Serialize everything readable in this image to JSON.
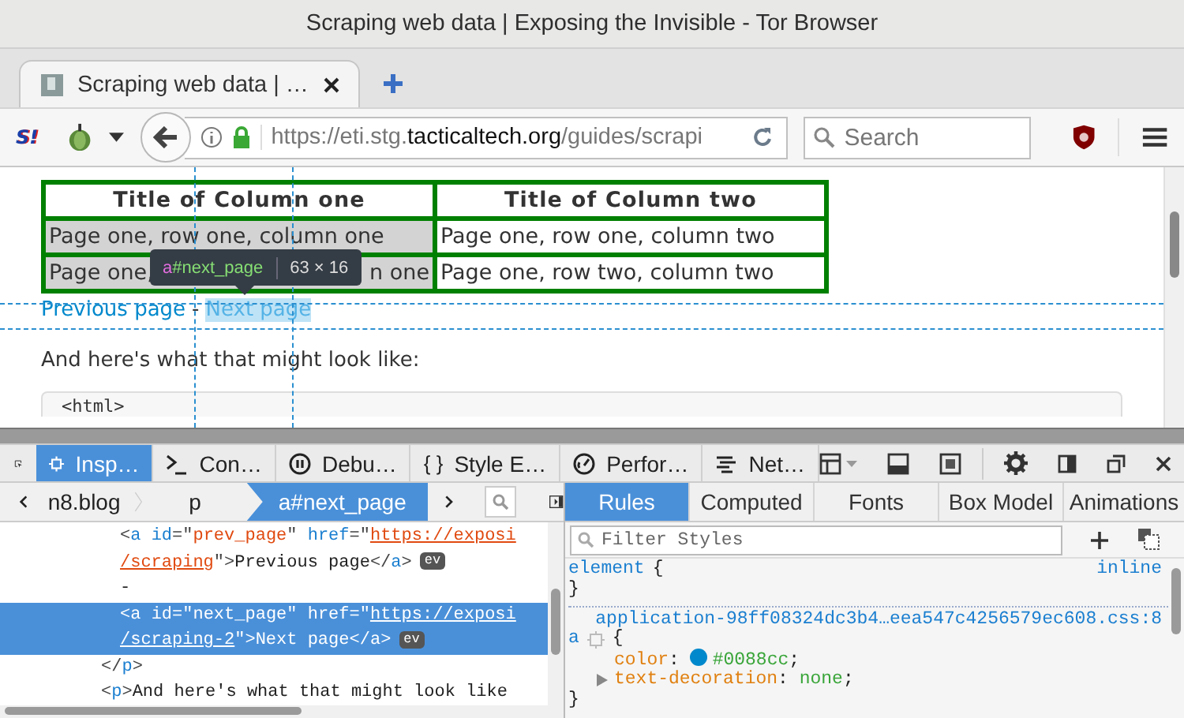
{
  "window": {
    "title": "Scraping web data | Exposing the Invisible - Tor Browser"
  },
  "tabs": [
    {
      "label": "Scraping web data | …",
      "selected": true
    }
  ],
  "toolbar": {
    "script_badge": "S!"
  },
  "address_bar": {
    "url_prefix": "https://eti.stg.",
    "url_domain": "tacticaltech.org",
    "url_path": "/guides/scrapi",
    "secure": true
  },
  "search": {
    "placeholder": "Search"
  },
  "page": {
    "table": {
      "columns": [
        "Title of Column one",
        "Title of Column two"
      ],
      "rows": [
        {
          "cells": [
            {
              "text": "Page one, row one, column one",
              "shaded": true
            },
            {
              "text": "Page one, row one, column two",
              "shaded": false
            }
          ]
        },
        {
          "cells": [
            {
              "segments": [
                "Page one,",
                "n one"
              ],
              "shaded": true
            },
            {
              "text": "Page one, row two, column two",
              "shaded": false
            }
          ]
        }
      ]
    },
    "links": [
      {
        "label": "Previous page",
        "highlighted": false
      },
      {
        "label": "Next page",
        "highlighted": true
      }
    ],
    "link_separator": "-",
    "paragraph": "And here's what that might look like:",
    "code": "<html>",
    "highlighter": {
      "tag": "a",
      "selector": "#next_page",
      "size": "63 × 16"
    }
  },
  "devtools": {
    "tools": [
      {
        "label": "Insp…",
        "kind": "inspector",
        "selected": true
      },
      {
        "label": "Con…",
        "kind": "console",
        "selected": false
      },
      {
        "label": "Debu…",
        "kind": "debugger",
        "selected": false
      },
      {
        "label": "Style E…",
        "kind": "style-editor",
        "glyph": "{ }",
        "selected": false
      },
      {
        "label": "Perfor…",
        "kind": "performance",
        "selected": false
      },
      {
        "label": "Net…",
        "kind": "network",
        "selected": false
      }
    ],
    "breadcrumbs": [
      {
        "label": "n8.blog",
        "selected": false
      },
      {
        "label": "p",
        "selected": false
      },
      {
        "label": "a#next_page",
        "selected": true
      }
    ],
    "side_tabs": [
      {
        "label": "Rules",
        "selected": true
      },
      {
        "label": "Computed",
        "selected": false
      },
      {
        "label": "Fonts",
        "selected": false
      },
      {
        "label": "Box Model",
        "selected": false
      },
      {
        "label": "Animations",
        "selected": false
      }
    ],
    "markup": [
      {
        "closing": [
          {
            "t": "</",
            "kind": "punct"
          },
          {
            "t": "p",
            "kind": "tag"
          },
          {
            "t": ">",
            "kind": "punct"
          }
        ],
        "children": [
          {
            "selected": false,
            "badge": "ev",
            "lines": [
              [
                {
                  "t": "<",
                  "kind": "punct"
                },
                {
                  "t": "a",
                  "kind": "tag"
                },
                {
                  "t": " id",
                  "kind": "attr"
                },
                {
                  "t": "=\"",
                  "kind": "punct"
                },
                {
                  "t": "prev_page",
                  "kind": "value"
                },
                {
                  "t": "\" ",
                  "kind": "punct"
                },
                {
                  "t": "href",
                  "kind": "attr"
                },
                {
                  "t": "=\"",
                  "kind": "punct"
                },
                {
                  "t": "https://exposi",
                  "kind": "link"
                }
              ],
              [
                {
                  "t": "/scraping",
                  "kind": "link"
                },
                {
                  "t": "\">",
                  "kind": "punct"
                },
                {
                  "t": "Previous page",
                  "kind": "text"
                },
                {
                  "t": "</",
                  "kind": "punct"
                },
                {
                  "t": "a",
                  "kind": "tag"
                },
                {
                  "t": ">",
                  "kind": "punct"
                }
              ]
            ]
          },
          {
            "selected": false,
            "lines": [
              [
                {
                  "t": "-",
                  "kind": "text"
                }
              ]
            ]
          },
          {
            "selected": true,
            "badge": "ev",
            "lines": [
              [
                {
                  "t": "<",
                  "kind": "punct"
                },
                {
                  "t": "a",
                  "kind": "tag"
                },
                {
                  "t": " id",
                  "kind": "attr"
                },
                {
                  "t": "=\"",
                  "kind": "punct"
                },
                {
                  "t": "next_page",
                  "kind": "value"
                },
                {
                  "t": "\" ",
                  "kind": "punct"
                },
                {
                  "t": "href",
                  "kind": "attr"
                },
                {
                  "t": "=\"",
                  "kind": "punct"
                },
                {
                  "t": "https://exposi",
                  "kind": "link"
                }
              ],
              [
                {
                  "t": "/scraping-2",
                  "kind": "link"
                },
                {
                  "t": "\">",
                  "kind": "punct"
                },
                {
                  "t": "Next page",
                  "kind": "text"
                },
                {
                  "t": "</",
                  "kind": "punct"
                },
                {
                  "t": "a",
                  "kind": "tag"
                },
                {
                  "t": ">",
                  "kind": "punct"
                }
              ]
            ]
          }
        ]
      },
      {
        "selected": false,
        "lines": [
          [
            {
              "t": "<",
              "kind": "punct"
            },
            {
              "t": "p",
              "kind": "tag"
            },
            {
              "t": ">",
              "kind": "punct"
            },
            {
              "t": "And here's what that might look like",
              "kind": "text"
            }
          ]
        ]
      }
    ],
    "filter": {
      "placeholder": "Filter Styles"
    },
    "rules": [
      {
        "kind": "inline",
        "selector": "element",
        "source": "inline",
        "open": "{",
        "close": "}"
      },
      {
        "kind": "stylesheet",
        "selector": "a",
        "source": "application-98ff08324dc3b4…eea547c4256579ec608.css:8",
        "open": "{",
        "close": "}",
        "declarations": [
          {
            "name": "color",
            "kind": "color",
            "separator": ":",
            "value": "#0088cc",
            "end": ";",
            "expandable": false
          },
          {
            "name": "text-decoration",
            "kind": "keyword",
            "separator": ":",
            "value": "none",
            "end": ";",
            "expandable": true
          }
        ]
      }
    ]
  }
}
